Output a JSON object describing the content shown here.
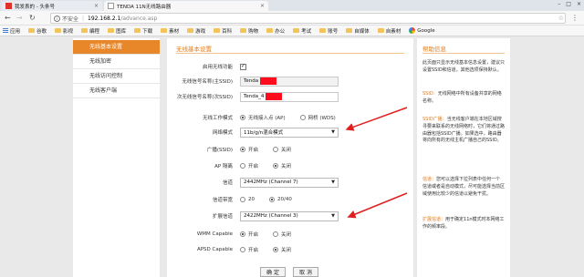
{
  "browser": {
    "tabs": [
      {
        "title": "我发表的 - 头条号",
        "active": false
      },
      {
        "title": "TENDA 11N无线路由器",
        "active": true
      }
    ],
    "address": {
      "insecure_label": "不安全",
      "host": "192.168.2.1",
      "path": "/advance.asp"
    },
    "bookmarks": [
      {
        "label": "应用",
        "icon": "apps-icon"
      },
      {
        "label": "谷歌",
        "icon": "folder-icon"
      },
      {
        "label": "影视",
        "icon": "folder-icon"
      },
      {
        "label": "编程",
        "icon": "folder-icon"
      },
      {
        "label": "图库",
        "icon": "folder-icon"
      },
      {
        "label": "下载",
        "icon": "folder-icon"
      },
      {
        "label": "素材",
        "icon": "folder-icon"
      },
      {
        "label": "游戏",
        "icon": "folder-icon"
      },
      {
        "label": "百科",
        "icon": "folder-icon"
      },
      {
        "label": "购物",
        "icon": "folder-icon"
      },
      {
        "label": "办公",
        "icon": "folder-icon"
      },
      {
        "label": "考试",
        "icon": "folder-icon"
      },
      {
        "label": "账号",
        "icon": "folder-icon"
      },
      {
        "label": "自媒体",
        "icon": "folder-icon"
      },
      {
        "label": "自素材",
        "icon": "folder-icon"
      },
      {
        "label": "Google",
        "icon": "google-icon"
      }
    ]
  },
  "sidebar": {
    "items": [
      {
        "label": "无线基本设置",
        "active": true
      },
      {
        "label": "无线加密",
        "active": false
      },
      {
        "label": "无线访问控制",
        "active": false
      },
      {
        "label": "无线客户端",
        "active": false
      }
    ]
  },
  "main": {
    "title": "无线基本设置",
    "enable_wireless_label": "启用无线功能",
    "enable_wireless_checked": true,
    "ssid1_label": "无线信号名称(主SSID)",
    "ssid1_value": "Tenda",
    "ssid2_label": "次无线信号名称(次SSID)",
    "ssid2_value": "Tenda_4",
    "work_mode_label": "无线工作模式",
    "work_mode_options": [
      "无线接入点 (AP)",
      "网桥 (WDS)"
    ],
    "work_mode_selected": 0,
    "network_mode_label": "网络模式",
    "network_mode_value": "11b/g/n混合模式",
    "broadcast_label": "广播(SSID)",
    "broadcast_options": [
      "开启",
      "关闭"
    ],
    "broadcast_selected": 0,
    "ap_isolation_label": "AP 隔离",
    "ap_isolation_options": [
      "开启",
      "关闭"
    ],
    "ap_isolation_selected": 1,
    "channel_label": "信道",
    "channel_value": "2442MHz (Channel 7)",
    "bandwidth_label": "信道带宽",
    "bandwidth_options": [
      "20",
      "20/40"
    ],
    "bandwidth_selected": 1,
    "ext_channel_label": "扩展信道",
    "ext_channel_value": "2422MHz (Channel 3)",
    "wmm_label": "WMM Capable",
    "wmm_options": [
      "开启",
      "关闭"
    ],
    "wmm_selected": 0,
    "apsd_label": "APSD Capable",
    "apsd_options": [
      "开启",
      "关闭"
    ],
    "apsd_selected": 1,
    "ok_label": "确 定",
    "cancel_label": "取 消"
  },
  "help": {
    "title": "帮助信息",
    "p1": "此页面只显示无线基本信息设置，建议只设置SSID和信道，其他选项保持默认。",
    "p2_key": "SSID：",
    "p2": "无线网络中所有设备共享的网络名称。",
    "p3_key": "SSID广播：",
    "p3": "当无线客户端在本地区域搜寻要来联系的无线网络时，它们将通过路由器包括SSID广播。如果选中，路由器将向所有的无线主机广播自己的SSID。",
    "p4_key": "信道：",
    "p4": "您可以选择下拉列表中任何一个信道或者是自动模式，尽可能选择当前区域使用比较少的信道以避免干扰。",
    "p5_key": "扩展信道：",
    "p5": "用于确定11n模式时本网络工作的频率段。"
  },
  "colors": {
    "accent": "#e8872a",
    "annotation": "#e02020",
    "redaction": "#ff0d1e"
  }
}
